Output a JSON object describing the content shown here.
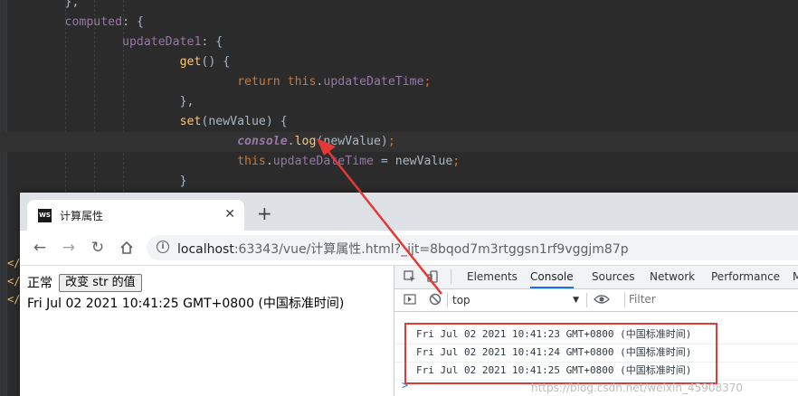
{
  "editor": {
    "lines": [
      {
        "indent": "    ",
        "parts": [
          {
            "t": "},",
            "c": "plain"
          }
        ]
      },
      {
        "indent": "    ",
        "parts": [
          {
            "t": "computed",
            "c": "prop"
          },
          {
            "t": ": {",
            "c": "plain"
          }
        ]
      },
      {
        "indent": "        ",
        "parts": [
          {
            "t": "updateDate1",
            "c": "prop"
          },
          {
            "t": ": {",
            "c": "plain"
          }
        ]
      },
      {
        "indent": "            ",
        "parts": [
          {
            "t": "get",
            "c": "fn"
          },
          {
            "t": "() {",
            "c": "plain"
          }
        ]
      },
      {
        "indent": "                ",
        "parts": [
          {
            "t": "return ",
            "c": "kw"
          },
          {
            "t": "this",
            "c": "kw"
          },
          {
            "t": ".",
            "c": "plain"
          },
          {
            "t": "updateDateTime",
            "c": "prop"
          },
          {
            "t": ";",
            "c": "kw"
          }
        ]
      },
      {
        "indent": "            ",
        "parts": [
          {
            "t": "},",
            "c": "plain"
          }
        ]
      },
      {
        "indent": "            ",
        "parts": [
          {
            "t": "set",
            "c": "fn"
          },
          {
            "t": "(newValue) {",
            "c": "plain"
          }
        ]
      },
      {
        "indent": "                ",
        "parts": [
          {
            "t": "console",
            "c": "const"
          },
          {
            "t": ".",
            "c": "plain"
          },
          {
            "t": "log",
            "c": "fn"
          },
          {
            "t": "(newValue)",
            "c": "plain"
          },
          {
            "t": ";",
            "c": "kw"
          }
        ],
        "highlight": true
      },
      {
        "indent": "                ",
        "parts": [
          {
            "t": "this",
            "c": "kw"
          },
          {
            "t": ".",
            "c": "plain"
          },
          {
            "t": "updateDateTime",
            "c": "prop"
          },
          {
            "t": " = newValue",
            "c": "plain"
          },
          {
            "t": ";",
            "c": "kw"
          }
        ]
      },
      {
        "indent": "            ",
        "parts": [
          {
            "t": "}",
            "c": "plain"
          }
        ]
      }
    ],
    "gutter_marks": [
      "</",
      "</",
      "</"
    ]
  },
  "browser": {
    "tab_title": "计算属性",
    "favicon_text": "WS",
    "url_host": "localhost",
    "url_rest": ":63343/vue/计算属性.html?_ijt=8bqod7m3rtggsn1rf9vggjm87p"
  },
  "page": {
    "status_text": "正常",
    "change_button": "改变 str 的值",
    "date_text": "Fri Jul 02 2021 10:41:25 GMT+0800 (中国标准时间)"
  },
  "devtools": {
    "tabs": [
      "Elements",
      "Console",
      "Sources",
      "Network",
      "Performance",
      "M"
    ],
    "active_tab": "Console",
    "context": "top",
    "filter_placeholder": "Filter",
    "logs": [
      "Fri Jul 02 2021 10:41:23 GMT+0800 (中国标准时间)",
      "Fri Jul 02 2021 10:41:24 GMT+0800 (中国标准时间)",
      "Fri Jul 02 2021 10:41:25 GMT+0800 (中国标准时间)"
    ],
    "prompt": ">",
    "watermark": "https://blog.csdn.net/weixin_45908370"
  },
  "colors": {
    "annotation": "#e53935",
    "editor_bg": "#2b2b2b",
    "keyword": "#cc7832",
    "property": "#9876aa",
    "function": "#ffc66d"
  }
}
